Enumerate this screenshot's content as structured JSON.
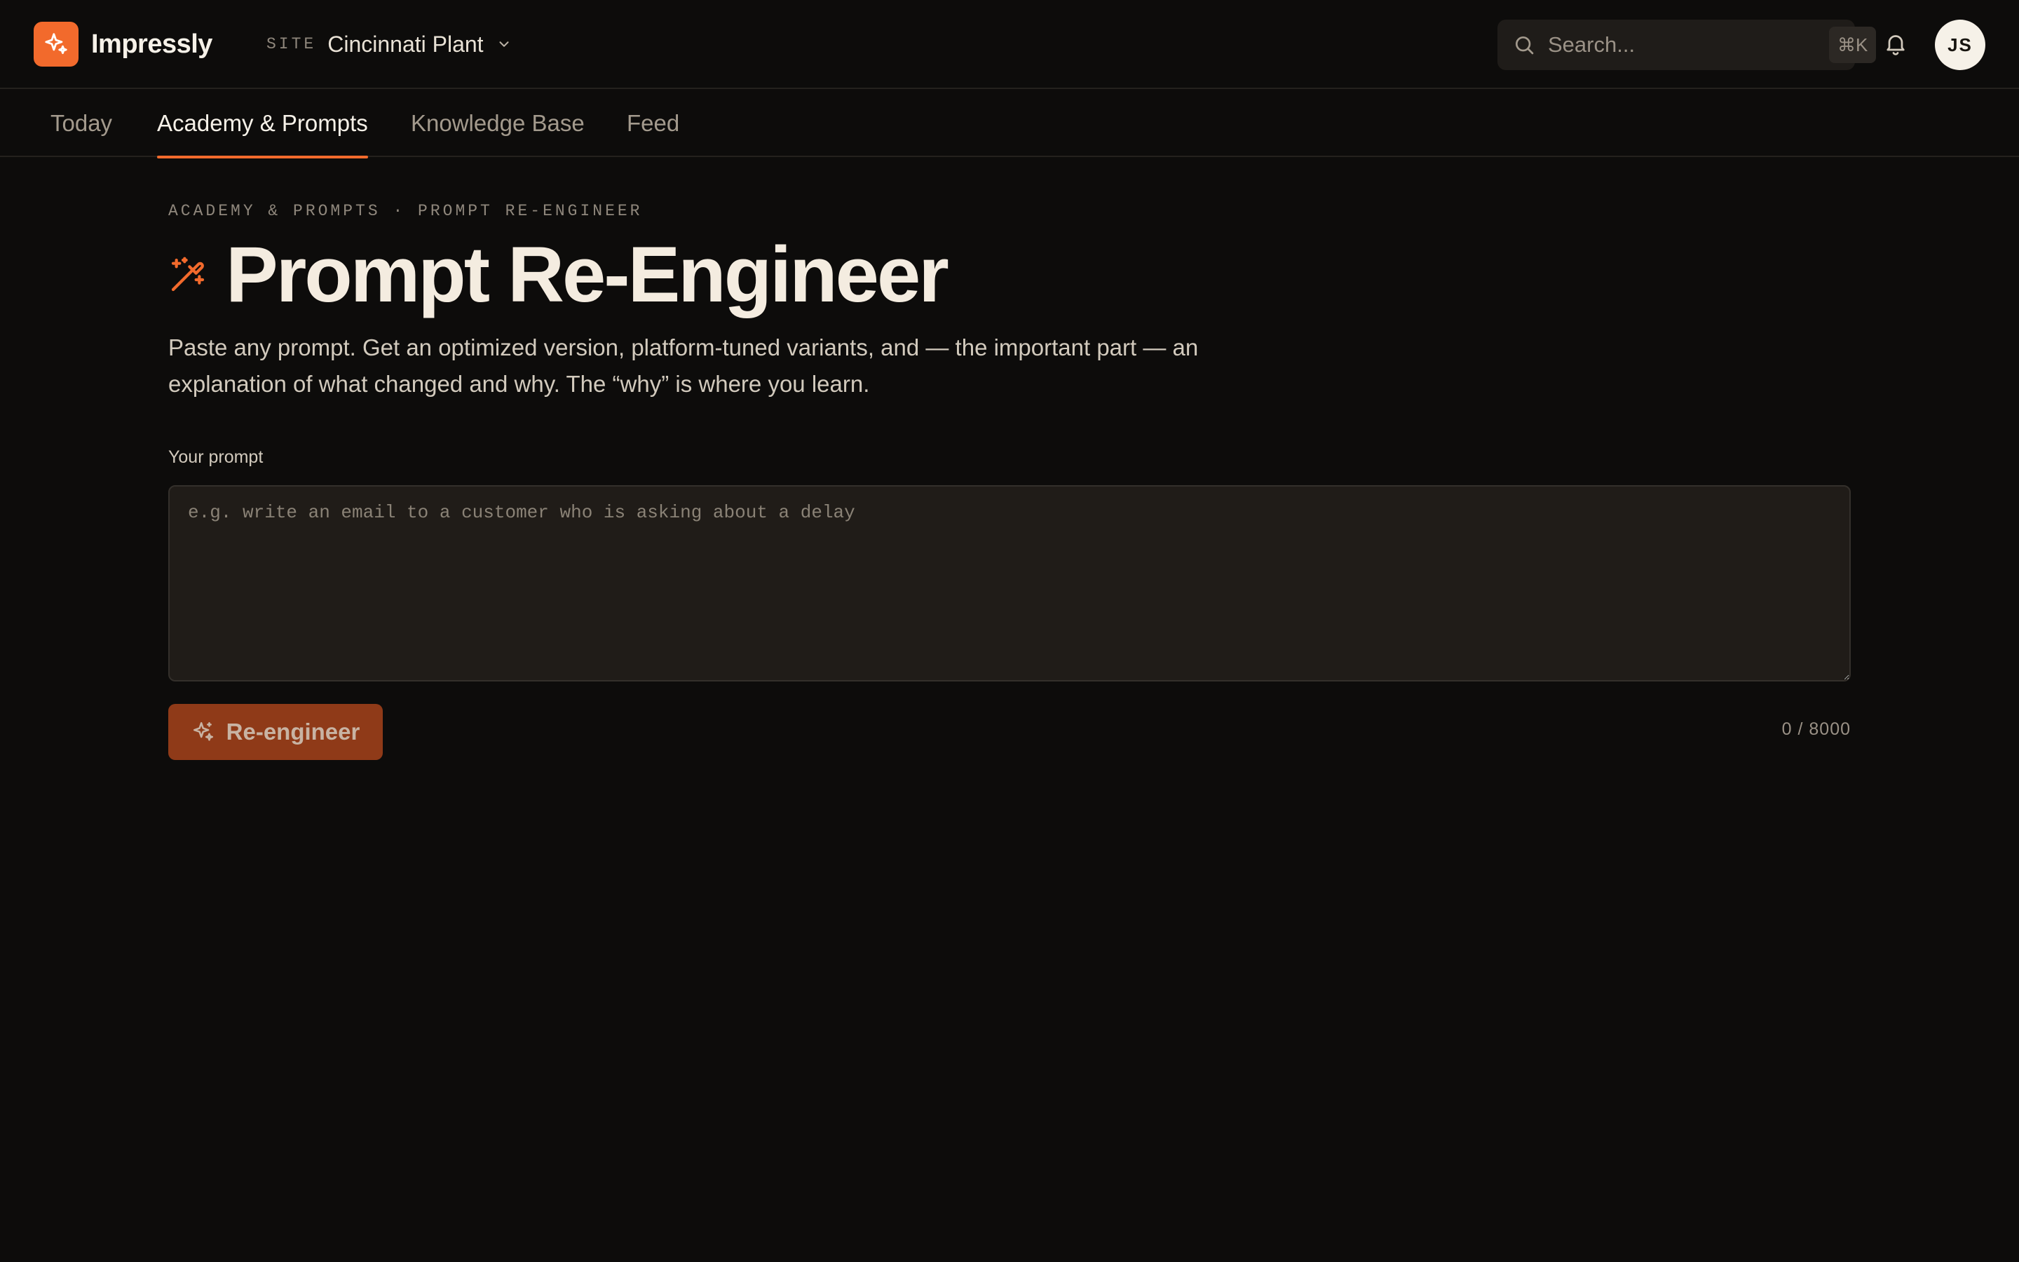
{
  "brand": {
    "name": "Impressly",
    "accent": "#f26a2c"
  },
  "site": {
    "label": "SITE",
    "name": "Cincinnati Plant"
  },
  "search": {
    "placeholder": "Search...",
    "shortcut": "⌘K"
  },
  "user": {
    "initials": "JS"
  },
  "tabs": [
    {
      "label": "Today",
      "active": false
    },
    {
      "label": "Academy & Prompts",
      "active": true
    },
    {
      "label": "Knowledge Base",
      "active": false
    },
    {
      "label": "Feed",
      "active": false
    }
  ],
  "page": {
    "breadcrumb": "ACADEMY & PROMPTS · PROMPT RE-ENGINEER",
    "title": "Prompt Re-Engineer",
    "subtitle": "Paste any prompt. Get an optimized version, platform-tuned variants, and — the important part — an explanation of what changed and why. The “why” is where you learn."
  },
  "form": {
    "field_label": "Your prompt",
    "placeholder": "e.g. write an email to a customer who is asking about a delay",
    "value": "",
    "submit_label": "Re-engineer",
    "char_count": "0 / 8000"
  },
  "icons": {
    "logo": "sparkles-icon",
    "site_chevron": "chevron-down-icon",
    "search": "search-icon",
    "notifications": "bell-icon",
    "title": "magic-wand-icon",
    "submit": "sparkles-icon"
  },
  "colors": {
    "background": "#0d0c0b",
    "surface": "#201c18",
    "accent": "#f26a2c",
    "button_disabled": "#8f3a18"
  }
}
